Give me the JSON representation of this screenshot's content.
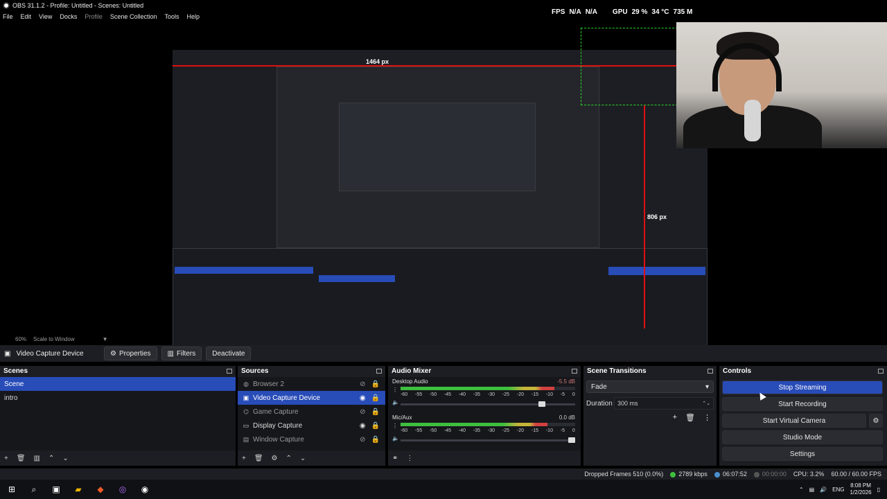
{
  "window": {
    "title": "OBS 31.1.2 - Profile: Untitled - Scenes: Untitled"
  },
  "menu": [
    "File",
    "Edit",
    "View",
    "Docks",
    "Profile",
    "Scene Collection",
    "Tools",
    "Help"
  ],
  "stats": {
    "fps_label": "FPS",
    "fps_value": "N/A",
    "fps_value2": "N/A",
    "gpu_label": "GPU",
    "gpu_pct": "29 %",
    "gpu_temp": "34 °C",
    "gpu_mem": "735 M"
  },
  "preview": {
    "measure_h": "1464 px",
    "measure_v": "806 px",
    "zoom": "60%",
    "scale_mode": "Scale to Window"
  },
  "context_bar": {
    "source_name": "Video Capture Device",
    "properties": "Properties",
    "filters": "Filters",
    "deactivate": "Deactivate"
  },
  "scenes": {
    "title": "Scenes",
    "items": [
      "Scene",
      "intro"
    ]
  },
  "sources": {
    "title": "Sources",
    "items": [
      {
        "name": "Browser 2",
        "icon": "globe-icon"
      },
      {
        "name": "Video Capture Device",
        "icon": "camera-icon"
      },
      {
        "name": "Game Capture",
        "icon": "gamepad-icon"
      },
      {
        "name": "Display Capture",
        "icon": "monitor-icon"
      },
      {
        "name": "Window Capture",
        "icon": "window-icon"
      }
    ]
  },
  "audio_mixer": {
    "title": "Audio Mixer",
    "channels": [
      {
        "name": "Desktop Audio",
        "db": "-5.5 dB",
        "level": 0.88,
        "volume": 0.83
      },
      {
        "name": "Mic/Aux",
        "db": "0.0 dB",
        "level": 0.84,
        "volume": 1.0
      }
    ],
    "ticks": [
      "-60",
      "-55",
      "-50",
      "-45",
      "-40",
      "-35",
      "-30",
      "-25",
      "-20",
      "-15",
      "-10",
      "-5",
      "0"
    ]
  },
  "transitions": {
    "title": "Scene Transitions",
    "selected": "Fade",
    "duration_label": "Duration",
    "duration_value": "300 ms"
  },
  "controls": {
    "title": "Controls",
    "stop_streaming": "Stop Streaming",
    "start_recording": "Start Recording",
    "start_virtual_camera": "Start Virtual Camera",
    "studio_mode": "Studio Mode",
    "settings": "Settings"
  },
  "status": {
    "dropped": "Dropped Frames 510 (0.0%)",
    "bitrate": "2789 kbps",
    "stream_time": "06:07:52",
    "rec_time": "00:00:00",
    "cpu": "CPU: 3.2%",
    "fps": "60.00 / 60.00 FPS"
  },
  "taskbar": {
    "lang": "ENG",
    "time": "8:08 PM",
    "date": "1/2/2026"
  },
  "colors": {
    "accent": "#284cb8",
    "meter_green": "#3fbf3f",
    "meter_yellow": "#c6b43a",
    "meter_red": "#d24040",
    "measure_red": "#e01010",
    "selection_green": "#27d827"
  }
}
